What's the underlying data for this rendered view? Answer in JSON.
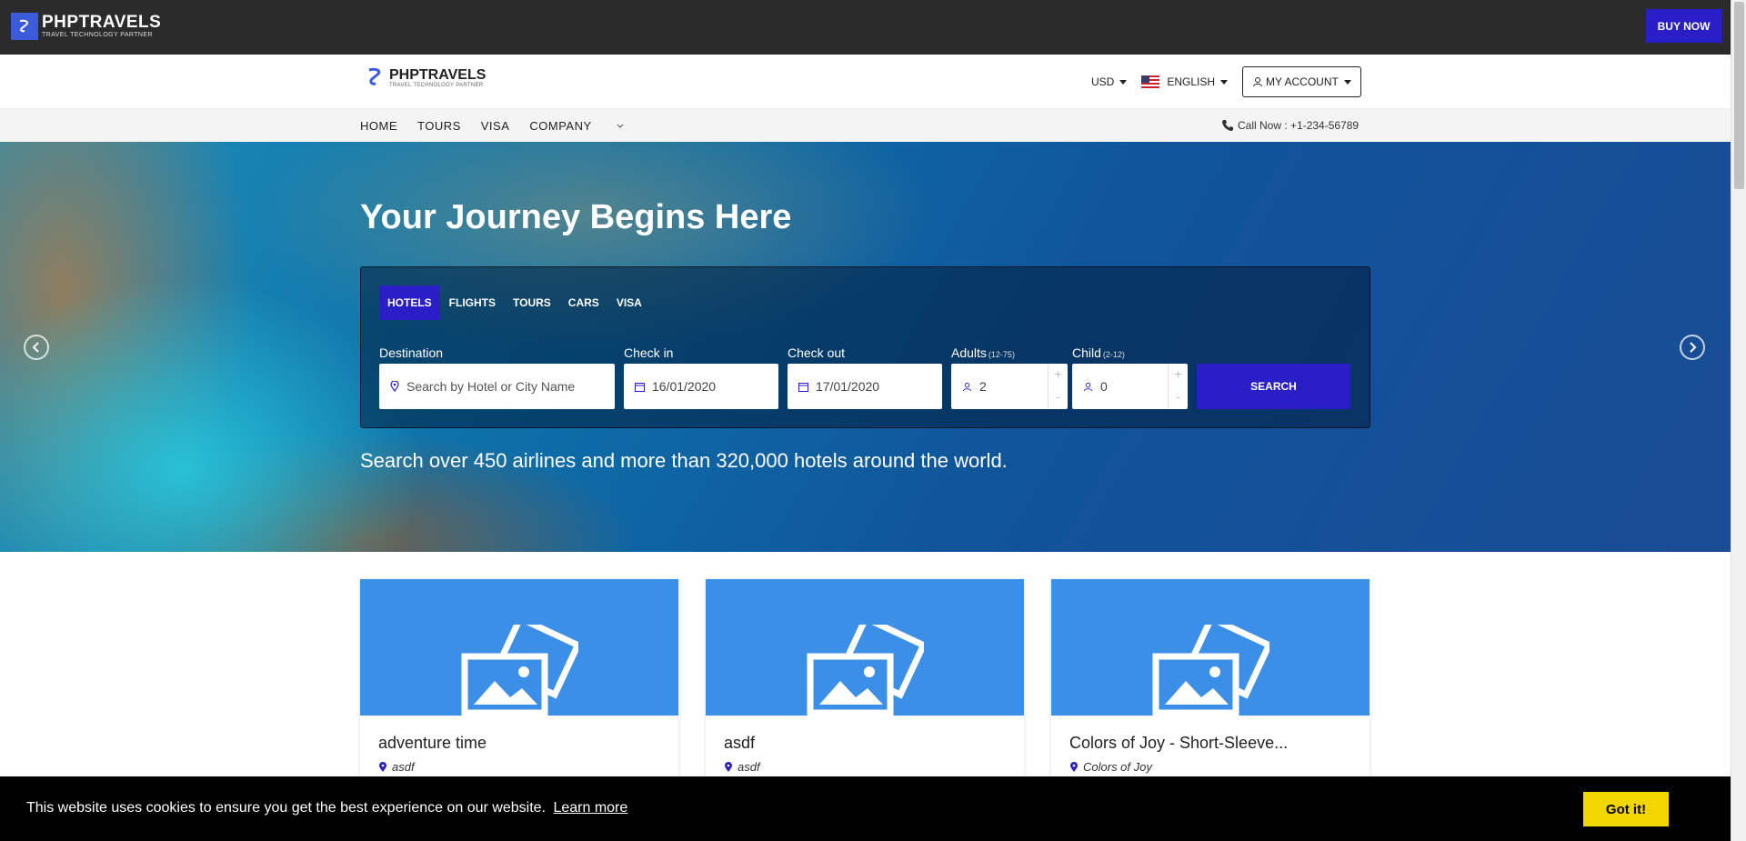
{
  "topbar": {
    "brand_name": "PHPTRAVELS",
    "brand_tagline": "TRAVEL TECHNOLOGY PARTNER",
    "buy_now": "BUY NOW"
  },
  "header": {
    "logo_name": "PHPTRAVELS",
    "logo_tagline": "TRAVEL TECHNOLOGY PARTNER",
    "currency": "USD",
    "language": "ENGLISH",
    "account": "MY ACCOUNT"
  },
  "nav": {
    "items": [
      "HOME",
      "TOURS",
      "VISA",
      "COMPANY"
    ],
    "call_now": "Call Now : +1-234-56789"
  },
  "hero": {
    "title": "Your Journey Begins Here",
    "subtitle": "Search over 450 airlines and more than 320,000 hotels around the world."
  },
  "search": {
    "tabs": [
      "HOTELS",
      "FLIGHTS",
      "TOURS",
      "CARS",
      "VISA"
    ],
    "active_tab": "HOTELS",
    "destination_label": "Destination",
    "destination_placeholder": "Search by Hotel or City Name",
    "checkin_label": "Check in",
    "checkin_value": "16/01/2020",
    "checkout_label": "Check out",
    "checkout_value": "17/01/2020",
    "adults_label": "Adults",
    "adults_range": "(12-75)",
    "adults_value": "2",
    "child_label": "Child",
    "child_range": "(2-12)",
    "child_value": "0",
    "plus": "+",
    "minus": "-",
    "button": "SEARCH"
  },
  "cards": [
    {
      "title": "adventure time",
      "location": "asdf"
    },
    {
      "title": "asdf",
      "location": "asdf"
    },
    {
      "title": "Colors of Joy - Short-Sleeve...",
      "location": "Colors of Joy"
    }
  ],
  "cookie": {
    "text": "This website uses cookies to ensure you get the best experience on our website.",
    "learn_more": "Learn more",
    "got_it": "Got it!"
  },
  "colors": {
    "accent": "#2a1fc7",
    "card_image": "#3b8fe6",
    "cookie_button": "#f1d600"
  }
}
